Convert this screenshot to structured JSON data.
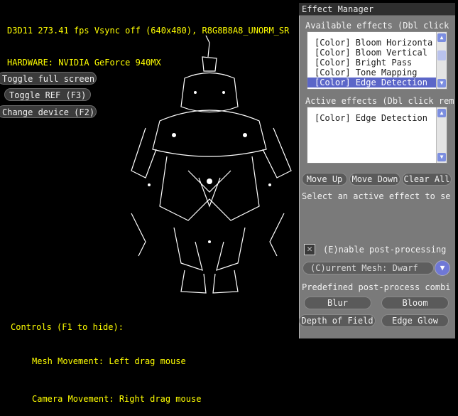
{
  "stats": {
    "line1": "D3D11 273.41 fps Vsync off (640x480), R8G8B8A8_UNORM_SR",
    "line2": "HARDWARE: NVIDIA GeForce 940MX"
  },
  "hud": {
    "toggle_full_screen": "Toggle full screen",
    "toggle_ref": "Toggle REF (F3)",
    "change_device": "Change device (F2)"
  },
  "help": {
    "title": "Controls (F1 to hide):",
    "mesh": "Mesh Movement: Left drag mouse",
    "camera": "Camera Movement: Right drag mouse"
  },
  "effect_manager": {
    "title": "Effect Manager",
    "available_label": "Available effects (Dbl click",
    "available_items": [
      "[Color] Bloom Horizonta",
      "[Color] Bloom Vertical",
      "[Color] Bright Pass",
      "[Color] Tone Mapping",
      "[Color] Edge Detection"
    ],
    "active_label": "Active effects (Dbl click rem",
    "active_items": [
      "[Color] Edge Detection"
    ],
    "move_up": "Move Up",
    "move_down": "Move Down",
    "clear_all": "Clear All",
    "select_hint": "Select an active effect to se",
    "enable_label": "(E)nable post-processing",
    "current_mesh": "(C)urrent Mesh: Dwarf",
    "predefined_label": "Predefined post-process combi",
    "blur": "Blur",
    "bloom": "Bloom",
    "depth_of_field": "Depth of Field",
    "edge_glow": "Edge Glow"
  },
  "icons": {
    "scroll_up": "scroll-up-icon",
    "scroll_down": "scroll-down-icon",
    "dropdown": "chevron-down-icon",
    "checkbox": "checkbox-icon"
  },
  "colors": {
    "hud_text": "#ffff00",
    "selection": "#5b66c8",
    "accent": "#6f78d6"
  }
}
